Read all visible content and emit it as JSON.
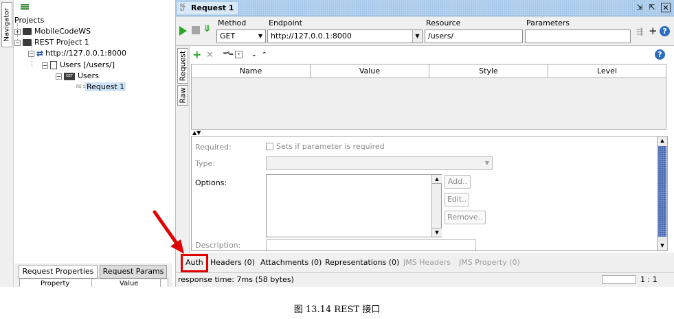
{
  "navigator": {
    "tab_label": "Navigator"
  },
  "tree": {
    "root": "Projects",
    "items": [
      {
        "label": "MobileCodeWS"
      },
      {
        "label": "REST Project 1"
      },
      {
        "label": "http://127.0.0.1:8000"
      },
      {
        "label": "Users [/users/]"
      },
      {
        "label": "Users",
        "badge": "GET"
      },
      {
        "label": "Request 1",
        "icon_text": "RE ST"
      }
    ]
  },
  "properties_panel": {
    "tabs": [
      "Request Properties",
      "Request Params"
    ],
    "columns": [
      "Property",
      "Value"
    ]
  },
  "window": {
    "icon_text": "RE ST",
    "title": "Request 1",
    "controls": [
      "detach-icon",
      "maximize-icon",
      "close-icon"
    ]
  },
  "request": {
    "method_label": "Method",
    "method_value": "GET",
    "endpoint_label": "Endpoint",
    "endpoint_value": "http://127.0.0.1:8000",
    "resource_label": "Resource",
    "resource_value": "/users/",
    "parameters_label": "Parameters",
    "parameters_value": ""
  },
  "side_tabs": [
    "Request",
    "Raw"
  ],
  "params_table": {
    "columns": [
      "Name",
      "Value",
      "Style",
      "Level"
    ]
  },
  "details": {
    "required_label": "Required:",
    "required_check_label": "Sets if parameter is required",
    "type_label": "Type:",
    "options_label": "Options:",
    "add_button": "Add..",
    "edit_button": "Edit..",
    "remove_button": "Remove..",
    "description_label": "Description:"
  },
  "bottom_tabs": [
    {
      "label": "Auth",
      "enabled": true
    },
    {
      "label": "Headers (0)",
      "enabled": true
    },
    {
      "label": "Attachments (0)",
      "enabled": true
    },
    {
      "label": "Representations (0)",
      "enabled": true
    },
    {
      "label": "JMS Headers",
      "enabled": false
    },
    {
      "label": "JMS Property (0)",
      "enabled": false
    }
  ],
  "status": {
    "response_time": "response time: 7ms (58 bytes)",
    "cursor_position": "1 : 1"
  },
  "annotation": {
    "highlight_color": "#e00000"
  },
  "caption": "图 13.14    REST 接口"
}
